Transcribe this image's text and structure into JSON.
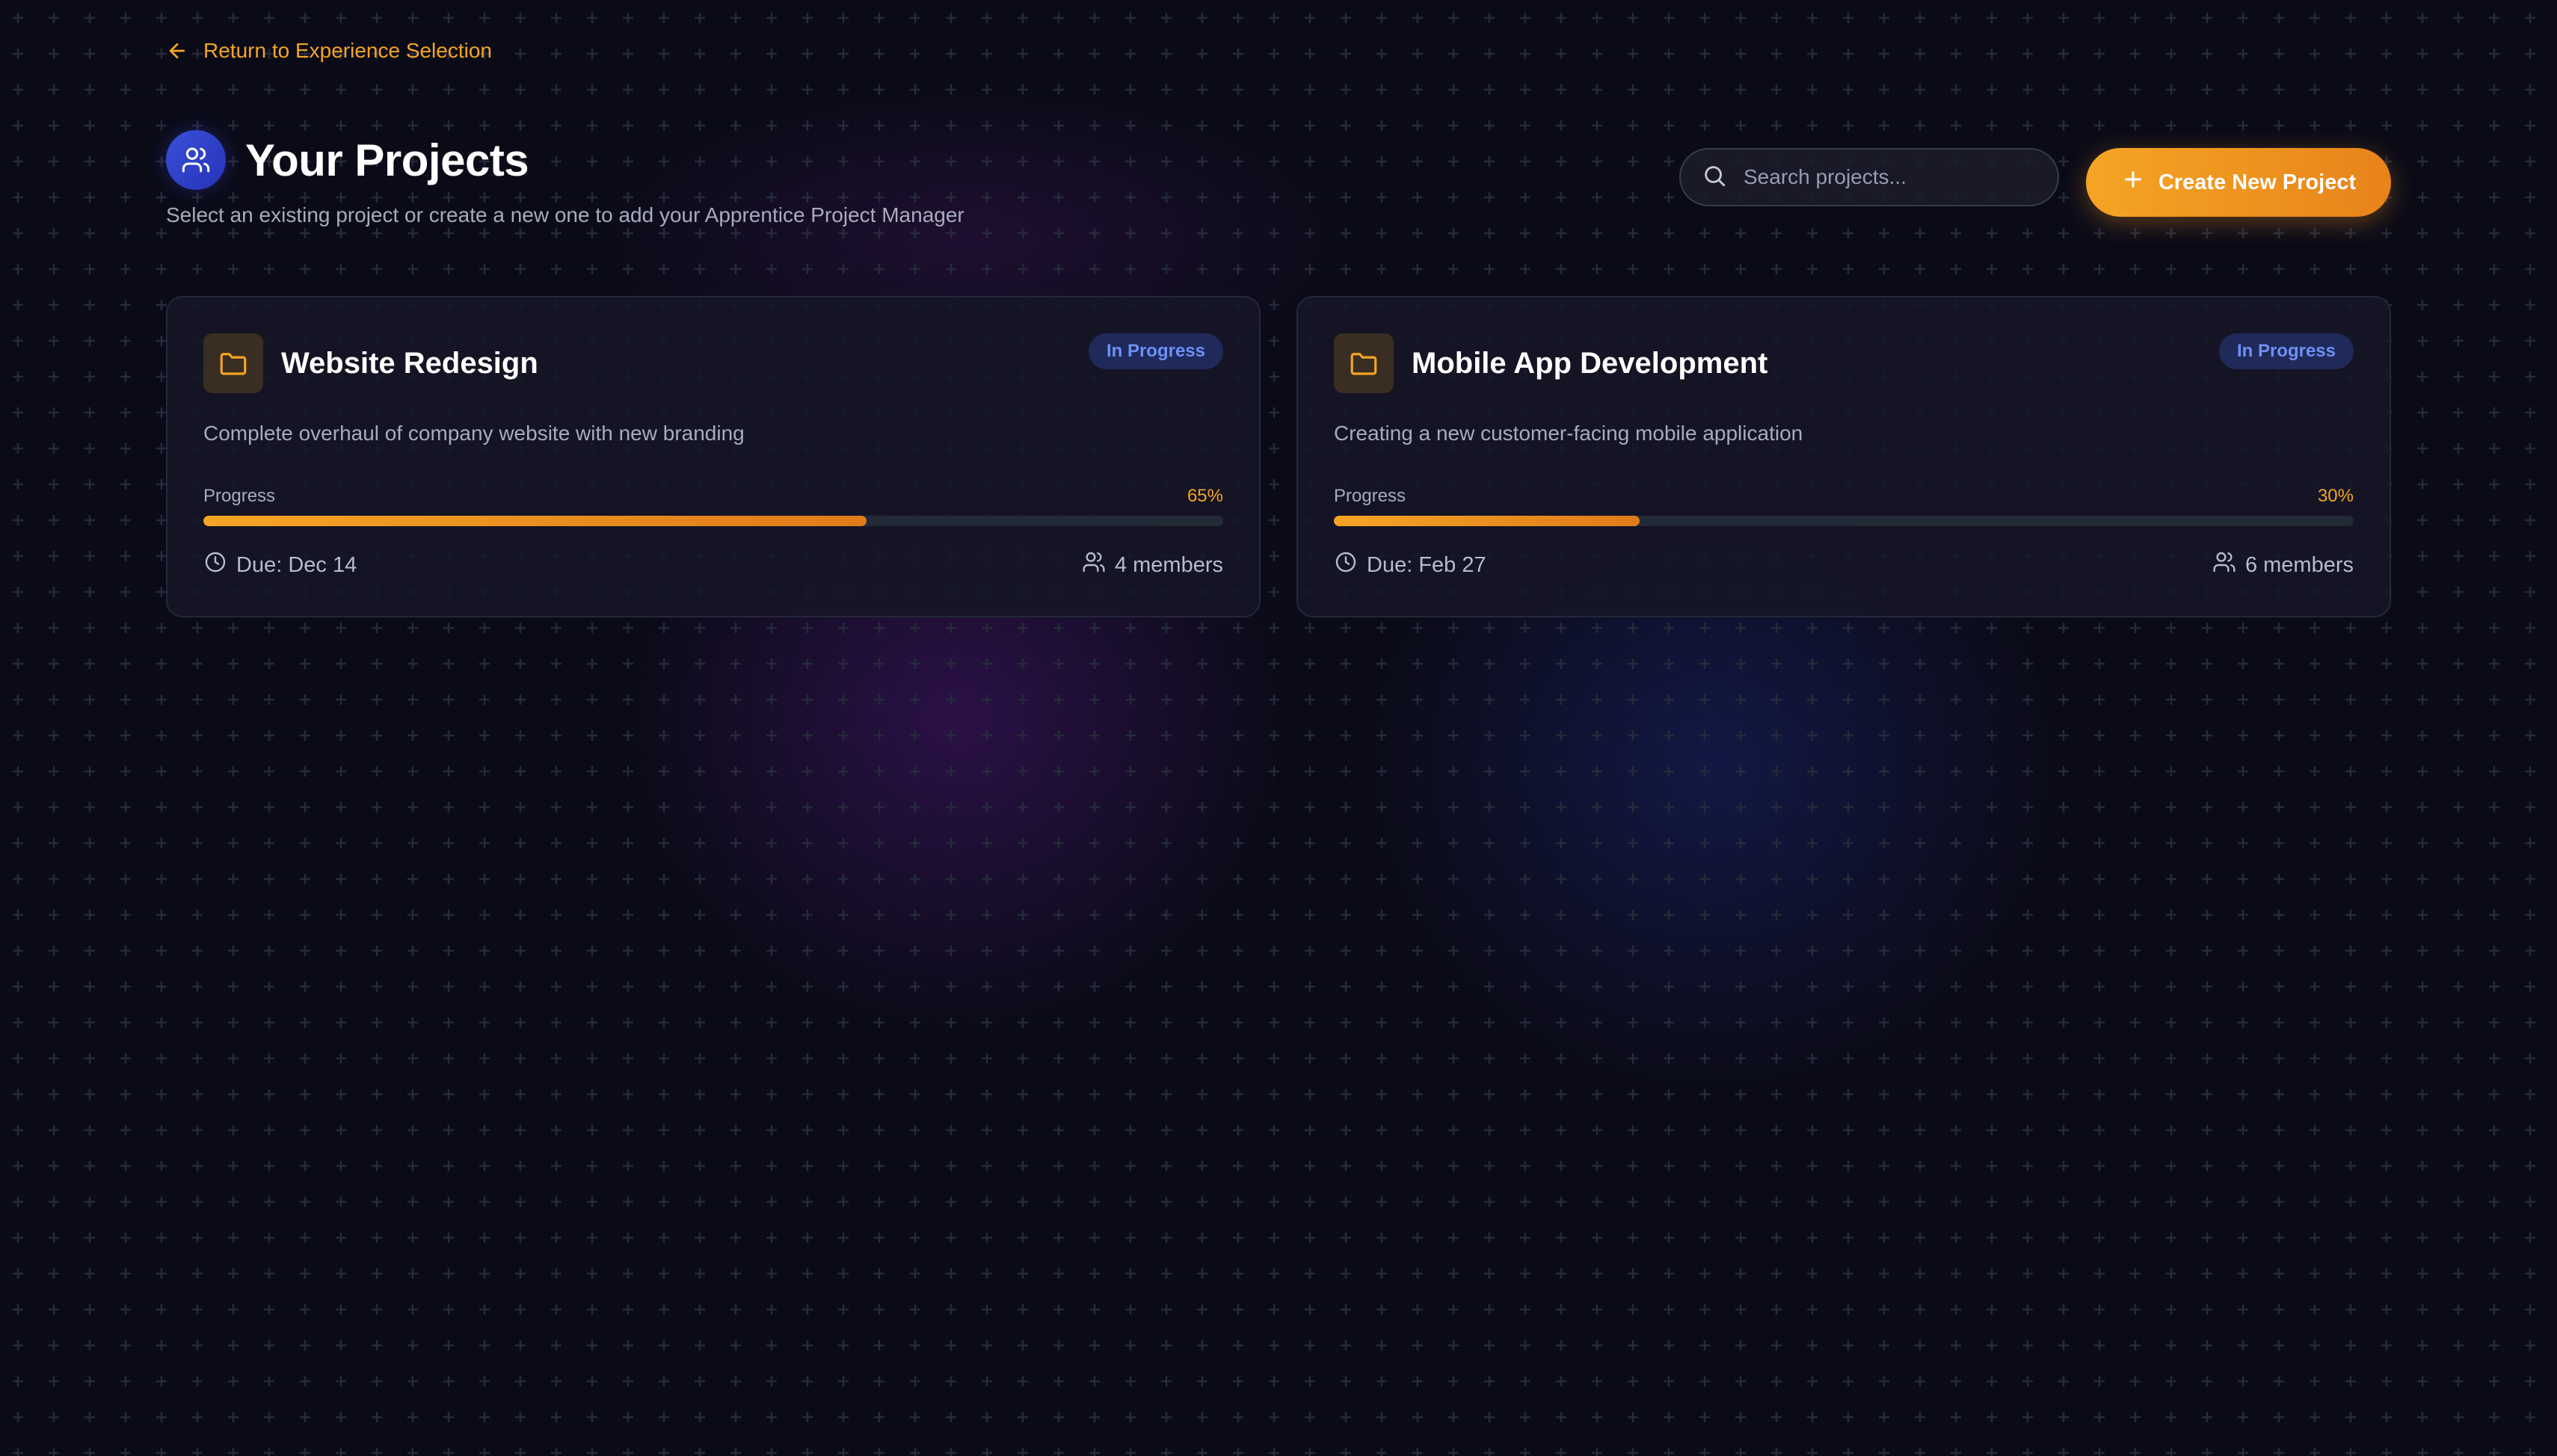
{
  "nav": {
    "back_label": "Return to Experience Selection"
  },
  "header": {
    "title": "Your Projects",
    "subtitle": "Select an existing project or create a new one to add your Apprentice Project Manager"
  },
  "search": {
    "placeholder": "Search projects...",
    "value": ""
  },
  "actions": {
    "create_label": "Create New Project"
  },
  "progress_label": "Progress",
  "projects": [
    {
      "title": "Website Redesign",
      "status": "In Progress",
      "description": "Complete overhaul of company website with new branding",
      "progress_text": "65%",
      "progress": 65,
      "due": "Due: Dec 14",
      "members": "4 members"
    },
    {
      "title": "Mobile App Development",
      "status": "In Progress",
      "description": "Creating a new customer-facing mobile application",
      "progress_text": "30%",
      "progress": 30,
      "due": "Due: Feb 27",
      "members": "6 members"
    }
  ],
  "colors": {
    "accent": "#f5a524",
    "background": "#0b0b18",
    "badge_text": "#6f8ff5",
    "badge_bg": "#1f2a5a"
  },
  "icons": {
    "back": "arrow-left-icon",
    "header": "users-icon",
    "search": "search-icon",
    "create": "plus-icon",
    "project": "folder-icon",
    "due": "clock-icon",
    "members": "users-icon"
  }
}
